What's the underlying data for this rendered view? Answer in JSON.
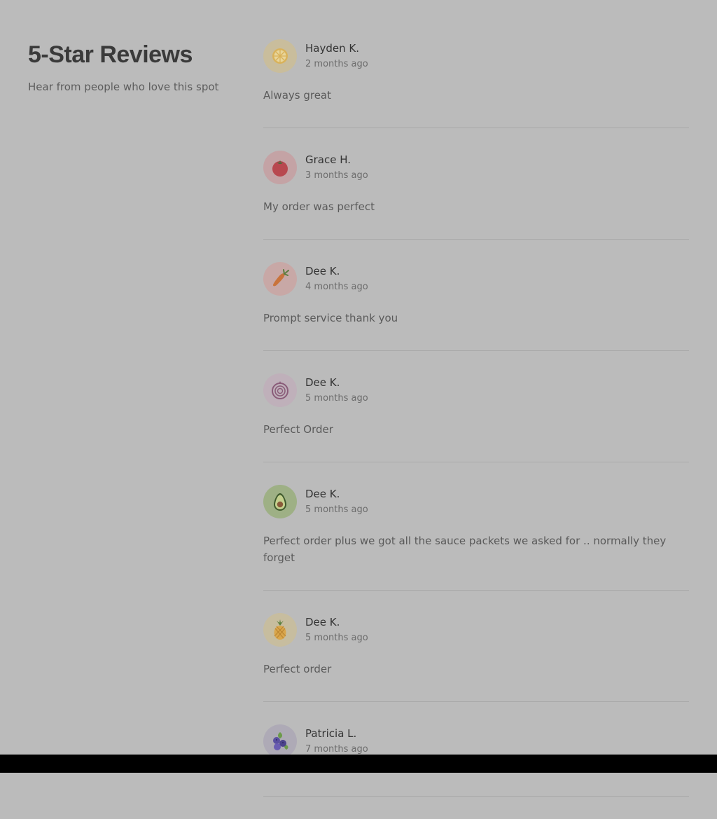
{
  "header": {
    "title": "5-Star Reviews",
    "subtitle": "Hear from people who love this spot"
  },
  "reviews": [
    {
      "name": "Hayden K.",
      "time": "2 months ago",
      "text": "Always great",
      "avatar_icon": "lemon-icon",
      "avatar_bg": "#c9bd9c"
    },
    {
      "name": "Grace H.",
      "time": "3 months ago",
      "text": "My order was perfect",
      "avatar_icon": "tomato-icon",
      "avatar_bg": "#c4a3a5"
    },
    {
      "name": "Dee K.",
      "time": "4 months ago",
      "text": "Prompt service thank you",
      "avatar_icon": "carrot-icon",
      "avatar_bg": "#c8a8a6"
    },
    {
      "name": "Dee K.",
      "time": "5 months ago",
      "text": "Perfect Order",
      "avatar_icon": "onion-icon",
      "avatar_bg": "#bfb0ba"
    },
    {
      "name": "Dee K.",
      "time": "5 months ago",
      "text": "Perfect order plus we got all the sauce packets we asked for .. normally they forget",
      "avatar_icon": "avocado-icon",
      "avatar_bg": "#9eb085"
    },
    {
      "name": "Dee K.",
      "time": "5 months ago",
      "text": "Perfect order",
      "avatar_icon": "pineapple-icon",
      "avatar_bg": "#c7bd9f"
    },
    {
      "name": "Patricia L.",
      "time": "7 months ago",
      "text": "",
      "avatar_icon": "blueberry-icon",
      "avatar_bg": "#aeaab6"
    }
  ]
}
